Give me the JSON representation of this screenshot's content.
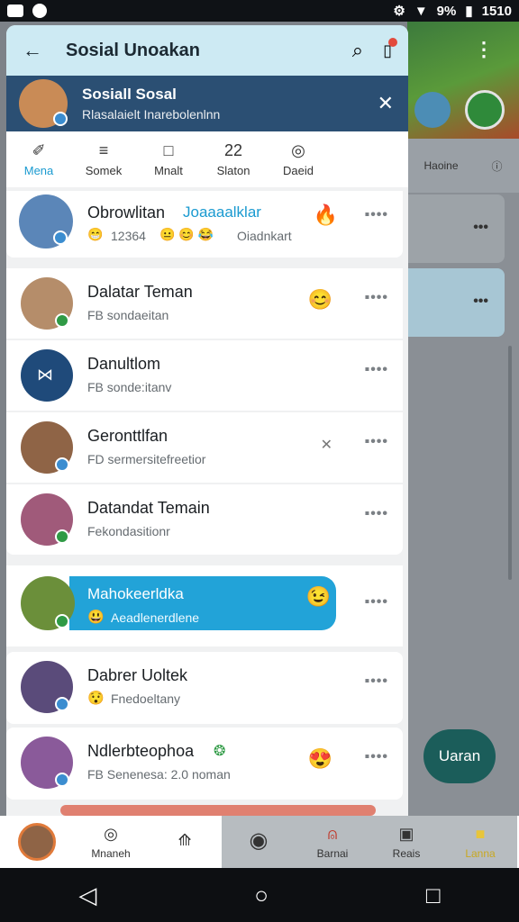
{
  "status": {
    "time": "1510",
    "battery": "9%"
  },
  "app": {
    "title": "Sosial Unoakan"
  },
  "banner": {
    "title": "Sosiall Sosal",
    "subtitle": "Rlasalaielt Inarebolenlnn"
  },
  "categories": [
    {
      "label": "Mena",
      "icon": "✐"
    },
    {
      "label": "Somek",
      "icon": "≡"
    },
    {
      "label": "Mnalt",
      "icon": "□"
    },
    {
      "label": "Slaton",
      "icon": "22"
    },
    {
      "label": "Daeid",
      "icon": "◎"
    }
  ],
  "rows": [
    {
      "name": "Obrowlitan",
      "name_extra": "Joaaaalklar",
      "sub": "12364",
      "sub_extra": "Oiadnkart"
    },
    {
      "name": "Dalatar Teman",
      "sub": "FB sondaeitan"
    },
    {
      "name": "Danultlom",
      "sub": "FB sonde:itanv"
    },
    {
      "name": "Geronttlfan",
      "sub": "FD sermersitefreetior"
    },
    {
      "name": "Datandat Temain",
      "sub": "Fekondasitionr"
    },
    {
      "name": "Mahokeerldka",
      "sub": "Aeadlenerdlene"
    },
    {
      "name": "Dabrer Uoltek",
      "sub": "Fnedoeltany"
    },
    {
      "name": "Ndlerbteophoa",
      "sub": "FB Senenesa: 2.0 noman"
    }
  ],
  "bottom_nav": [
    {
      "label": ""
    },
    {
      "label": "Mnaneh"
    },
    {
      "label": ""
    },
    {
      "label": ""
    },
    {
      "label": "Barnai"
    },
    {
      "label": "Reais"
    },
    {
      "label": "Lanna"
    }
  ],
  "background": {
    "tab_label": "Haoine",
    "fab_label": "Uaran"
  },
  "colors": {
    "accent": "#22a3d8",
    "banner": "#2b4f73",
    "topbar": "#cdeaf3"
  }
}
